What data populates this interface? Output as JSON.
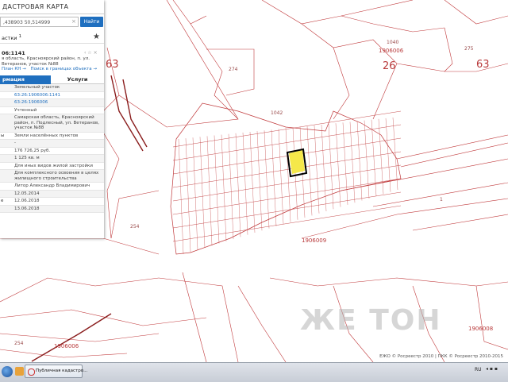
{
  "panel": {
    "title": "ДАСТРОВАЯ КАРТА",
    "search_value": ",438903 50,514999",
    "clear_symbol": "×",
    "find_label": "Найти",
    "sections_label": "астки",
    "sections_count": "1",
    "star_symbol": "★",
    "parcel_id": "06:1141",
    "parcel_actions": "‹  ☆  ×",
    "parcel_address": "я область, Красноярский район, п. ул. Ветеранов, участок №88",
    "links": [
      "План КН →",
      "Поиск в границах объекта →"
    ],
    "tabs": {
      "info": "рмация",
      "services": "Услуги"
    },
    "rows": [
      {
        "key": "",
        "value": "Земельный участок",
        "link": false
      },
      {
        "key": "",
        "value": "63:26:1906006:1141",
        "link": true
      },
      {
        "key": "",
        "value": "63:26:1906006",
        "link": true
      },
      {
        "key": "",
        "value": "Учтенный",
        "link": false
      },
      {
        "key": "",
        "value": "Самарская область, Красноярский район, п. Подлесный, ул. Ветеранов, участок №88",
        "link": false
      },
      {
        "key": "ы",
        "value": "Земли населённых пунктов",
        "link": false
      },
      {
        "key": "",
        "value": "-",
        "link": false
      },
      {
        "key": "",
        "value": "176 726,25 руб.",
        "link": false
      },
      {
        "key": "",
        "value": "1 125 кв. м",
        "link": false
      },
      {
        "key": "",
        "value": "Для иных видов жилой застройки",
        "link": false
      },
      {
        "key": "",
        "value": "Для комплексного освоения в целях жилищного строительства",
        "link": false
      },
      {
        "key": "",
        "value": "Литор Александр Владимирович",
        "link": false
      },
      {
        "key": "",
        "value": "12.05.2014",
        "link": false
      },
      {
        "key": "е",
        "value": "12.06.2018",
        "link": false
      },
      {
        "key": "",
        "value": "13.06.2018",
        "link": false
      }
    ]
  },
  "map": {
    "labels": {
      "zone_63_left": "63",
      "zone_63_right": "63",
      "zone_26": "26",
      "quarter_top": "1906006",
      "quarter_mid": "1906009",
      "quarter_bottom_left": "1906006",
      "quarter_bottom_right": "1906008",
      "parcel_274": "274",
      "parcel_275": "275",
      "parcel_1042": "1042",
      "parcel_1040": "1040",
      "parcel_254a": "254",
      "parcel_254b": "254",
      "parcel_1": "1"
    },
    "watermark": "ЖЕ ТОН",
    "copyright": "ЕЖО © Росреестр 2010 | ПКК © Росреестр 2010-2015",
    "line_color": "#c0393b",
    "highlight_color": "#f5e84a"
  },
  "taskbar": {
    "task_label": "Публичная кадастро...",
    "lang": "RU",
    "tray": "◂ ▪ ▪"
  }
}
